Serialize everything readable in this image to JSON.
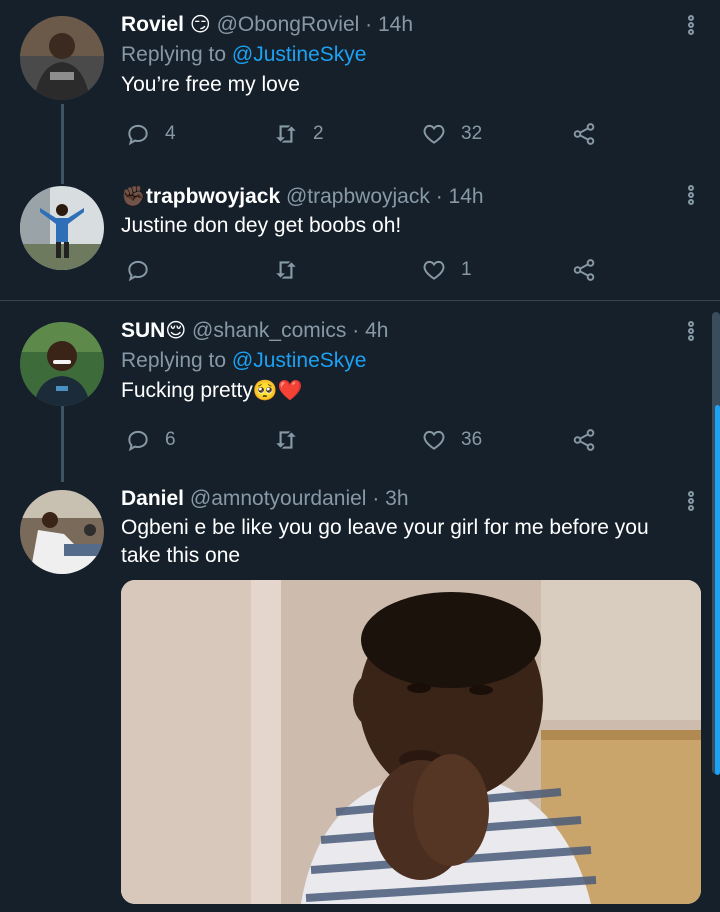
{
  "tweets": [
    {
      "name": "Roviel",
      "name_emoji": "😏",
      "handle": "@ObongRoviel",
      "time": "· 14h",
      "replying_prefix": "Replying to ",
      "replying_to": "@JustineSkye",
      "text": "You’re free my love",
      "replies": "4",
      "retweets": "2",
      "likes": "32"
    },
    {
      "name_emoji": "✊🏿",
      "name": "trapbwoyjack",
      "handle": "@trapbwoyjack",
      "time": "· 14h",
      "text": "Justine don dey get boobs oh!",
      "replies": "",
      "retweets": "",
      "likes": "1"
    },
    {
      "name": "SUN",
      "name_emoji": "😌",
      "handle": "@shank_comics",
      "time": "· 4h",
      "replying_prefix": "Replying to ",
      "replying_to": "@JustineSkye",
      "text": "Fucking pretty",
      "text_emoji": "🥺❤️",
      "replies": "6",
      "retweets": "",
      "likes": "36"
    },
    {
      "name": "Daniel",
      "handle": "@amnotyourdaniel",
      "time": "· 3h",
      "text": "Ogbeni e be like you go leave your girl for me before you take this one"
    }
  ],
  "icons": {
    "reply": "reply-icon",
    "retweet": "retweet-icon",
    "like": "heart-icon",
    "share": "share-icon",
    "more": "more-options-icon"
  },
  "colors": {
    "background": "#15202b",
    "text": "#ffffff",
    "muted": "#8899a6",
    "link": "#1da1f2",
    "divider": "#38444d"
  }
}
